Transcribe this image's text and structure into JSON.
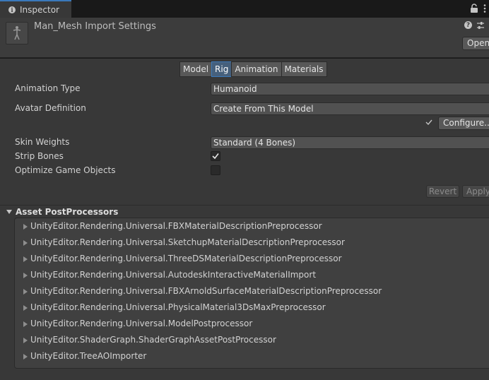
{
  "tab": {
    "label": "Inspector"
  },
  "header": {
    "title": "Man_Mesh Import Settings",
    "open_label": "Open"
  },
  "tabs": [
    {
      "label": "Model",
      "active": false
    },
    {
      "label": "Rig",
      "active": true
    },
    {
      "label": "Animation",
      "active": false
    },
    {
      "label": "Materials",
      "active": false
    }
  ],
  "rig": {
    "animation_type": {
      "label": "Animation Type",
      "value": "Humanoid"
    },
    "avatar_definition": {
      "label": "Avatar Definition",
      "value": "Create From This Model"
    },
    "configure_label": "Configure...",
    "skin_weights": {
      "label": "Skin Weights",
      "value": "Standard (4 Bones)"
    },
    "strip_bones": {
      "label": "Strip Bones",
      "checked": true
    },
    "optimize_game_objects": {
      "label": "Optimize Game Objects",
      "checked": false
    }
  },
  "actions": {
    "revert_label": "Revert",
    "apply_label": "Apply"
  },
  "postprocessors": {
    "title": "Asset PostProcessors",
    "items": [
      "UnityEditor.Rendering.Universal.FBXMaterialDescriptionPreprocessor",
      "UnityEditor.Rendering.Universal.SketchupMaterialDescriptionPreprocessor",
      "UnityEditor.Rendering.Universal.ThreeDSMaterialDescriptionPreprocessor",
      "UnityEditor.Rendering.Universal.AutodeskInteractiveMaterialImport",
      "UnityEditor.Rendering.Universal.FBXArnoldSurfaceMaterialDescriptionPreprocessor",
      "UnityEditor.Rendering.Universal.PhysicalMaterial3DsMaxPreprocessor",
      "UnityEditor.Rendering.Universal.ModelPostprocessor",
      "UnityEditor.ShaderGraph.ShaderGraphAssetPostProcessor",
      "UnityEditor.TreeAOImporter"
    ]
  },
  "icons": {
    "tab": "info-icon",
    "lock": "lock-icon",
    "menu": "kebab-menu-icon",
    "help": "help-icon",
    "settings": "preset-settings-icon",
    "thumbnail": "model-thumbnail-icon",
    "check": "check-icon"
  },
  "colors": {
    "accent": "#3a79bb",
    "active_tab": "#46607c",
    "background": "#383838"
  }
}
